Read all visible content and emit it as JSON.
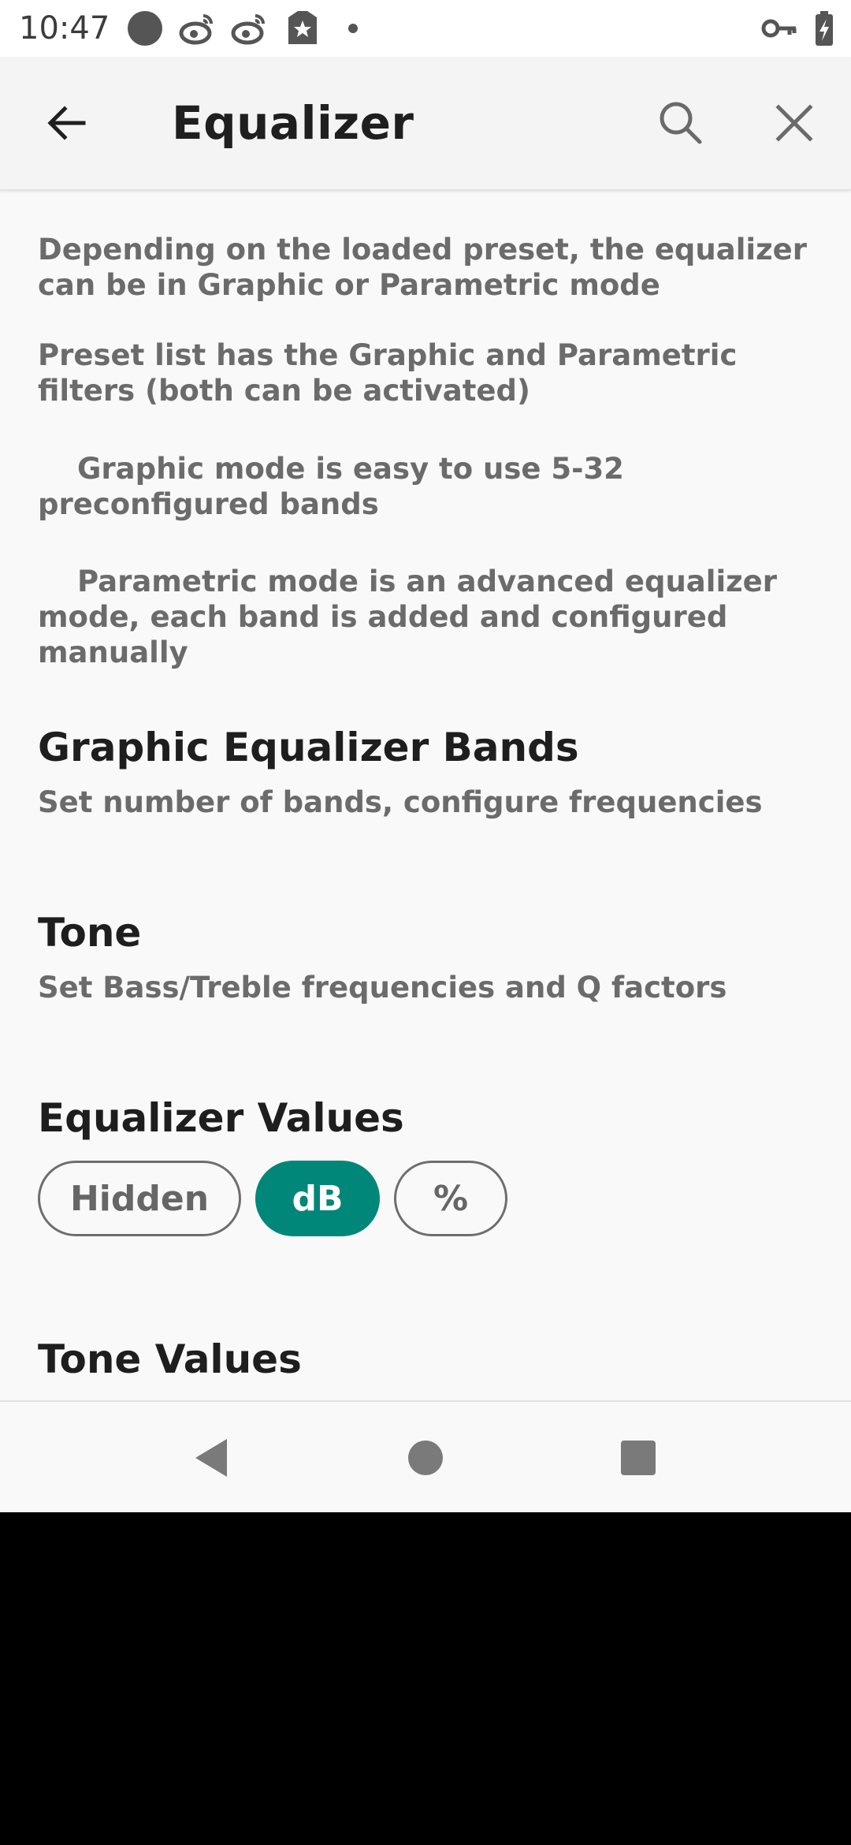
{
  "status_bar": {
    "time": "10:47",
    "icons_left": [
      "circle-icon",
      "weibo-icon",
      "weibo-icon",
      "tag-star-icon",
      "dot-icon"
    ],
    "icons_right": [
      "key-icon",
      "battery-charging-icon"
    ]
  },
  "app_bar": {
    "title": "Equalizer",
    "back_icon": "arrow-left-icon",
    "search_icon": "search-icon",
    "close_icon": "close-icon"
  },
  "intro": {
    "paragraph_1": "Depending on the loaded preset, the equalizer can be in Graphic or Parametric mode",
    "paragraph_2": "Preset list has the Graphic and Parametric filters (both can be activated)",
    "paragraph_3": "Graphic mode is easy to use 5-32 preconfigured bands",
    "paragraph_4": "Parametric mode is an advanced equalizer mode, each band is added and configured manually"
  },
  "sections": {
    "graphic_bands": {
      "title": "Graphic Equalizer Bands",
      "subtitle": "Set number of bands, configure frequencies"
    },
    "tone": {
      "title": "Tone",
      "subtitle": "Set Bass/Treble frequencies and Q factors"
    },
    "equalizer_values": {
      "title": "Equalizer Values",
      "options": [
        "Hidden",
        "dB",
        "%"
      ],
      "selected": "dB"
    },
    "tone_values": {
      "title": "Tone Values"
    }
  },
  "colors": {
    "accent": "#00877a",
    "background": "#f9f9f9",
    "app_bar": "#f4f4f4",
    "text_primary": "#1e1e1e",
    "text_secondary": "#6b6b6b"
  },
  "nav_bar": {
    "back": "nav-back-icon",
    "home": "nav-home-icon",
    "recents": "nav-recents-icon"
  }
}
